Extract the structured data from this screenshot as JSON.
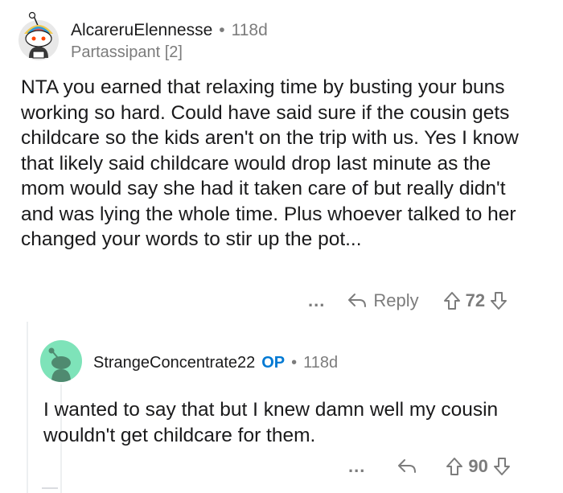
{
  "comments": [
    {
      "username": "AlcareruElennesse",
      "age": "118d",
      "flair": "Partassipant [2]",
      "body": "NTA you earned that relaxing time by busting your buns working so hard. Could have said sure if the cousin gets childcare so the kids aren't on the trip with us. Yes I know that likely said childcare would drop last minute as the mom would say she had it taken care of but really didn't and was lying the whole time. Plus whoever talked to her changed your words to stir up the pot...",
      "more": "...",
      "reply_label": "Reply",
      "score": "72"
    },
    {
      "username": "StrangeConcentrate22",
      "op_badge": "OP",
      "age": "118d",
      "body": "I wanted to say that but I knew damn well my cousin wouldn't get childcare for them.",
      "more": "...",
      "score": "90"
    }
  ],
  "separator": "•",
  "colors": {
    "text": "#1a1a1b",
    "meta": "#7c7c7c",
    "op": "#0079d3",
    "avatar2_bg": "#7ee3b9",
    "thread_line": "#edeff1"
  }
}
